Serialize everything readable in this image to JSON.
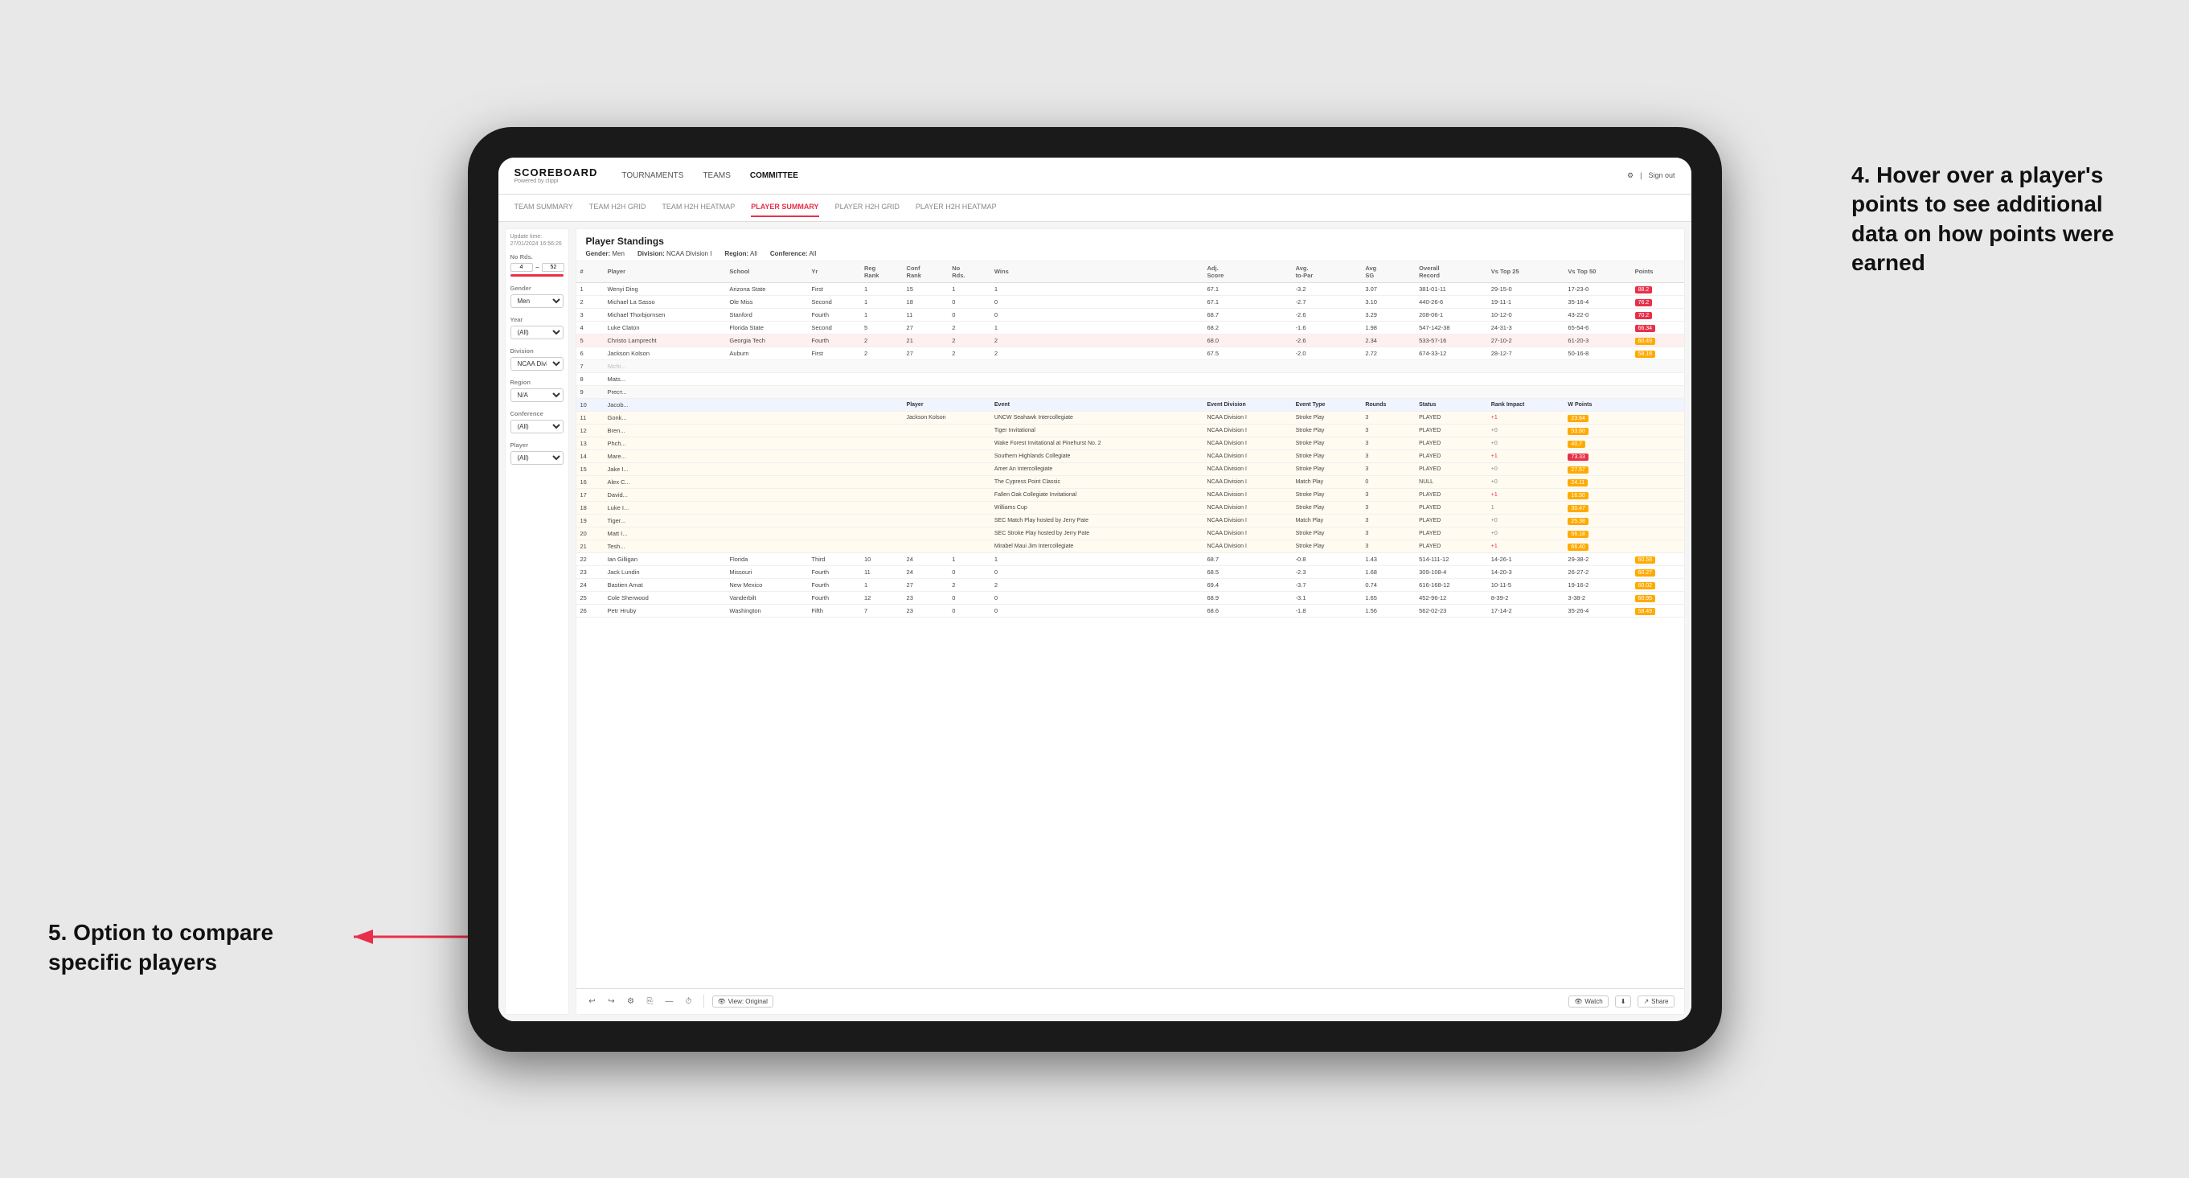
{
  "app": {
    "logo": "SCOREBOARD",
    "logo_sub": "Powered by clippi",
    "sign_out": "Sign out"
  },
  "nav": {
    "links": [
      "TOURNAMENTS",
      "TEAMS",
      "COMMITTEE"
    ],
    "active": "COMMITTEE"
  },
  "sub_nav": {
    "links": [
      "TEAM SUMMARY",
      "TEAM H2H GRID",
      "TEAM H2H HEATMAP",
      "PLAYER SUMMARY",
      "PLAYER H2H GRID",
      "PLAYER H2H HEATMAP"
    ],
    "active": "PLAYER SUMMARY"
  },
  "update_time_label": "Update time:",
  "update_time": "27/01/2024 16:56:26",
  "standings": {
    "title": "Player Standings",
    "filters": [
      {
        "label": "Gender:",
        "value": "Men"
      },
      {
        "label": "Division:",
        "value": "NCAA Division I"
      },
      {
        "label": "Region:",
        "value": "All"
      },
      {
        "label": "Conference:",
        "value": "All"
      }
    ]
  },
  "sidebar": {
    "no_rds_label": "No Rds.",
    "no_rds_min": "4",
    "no_rds_max": "52",
    "gender_label": "Gender",
    "gender_value": "Men",
    "year_label": "Year",
    "year_value": "(All)",
    "division_label": "Division",
    "division_value": "NCAA Division I",
    "region_label": "Region",
    "region_value": "N/A",
    "conference_label": "Conference",
    "conference_value": "(All)",
    "player_label": "Player",
    "player_value": "(All)"
  },
  "table_headers": [
    "#",
    "Player",
    "School",
    "Yr",
    "Reg Rank",
    "Conf Rank",
    "No Rds.",
    "Wins",
    "Adj. Score",
    "Avg to-Par",
    "Avg SG",
    "Overall Record",
    "Vs Top 25",
    "Vs Top 50",
    "Points"
  ],
  "players": [
    {
      "num": 1,
      "name": "Wenyi Ding",
      "school": "Arizona State",
      "yr": "First",
      "reg_rank": 1,
      "conf_rank": 15,
      "no_rds": 1,
      "wins": 1,
      "adj_score": 67.1,
      "to_par": -3.2,
      "avg_sg": 3.07,
      "overall": "381-01-11",
      "vs25": "29-15-0",
      "vs50": "17-23-0",
      "points": "88.2",
      "pts_class": "red"
    },
    {
      "num": 2,
      "name": "Michael La Sasso",
      "school": "Ole Miss",
      "yr": "Second",
      "reg_rank": 1,
      "conf_rank": 18,
      "no_rds": 0,
      "wins": 0,
      "adj_score": 67.1,
      "to_par": -2.7,
      "avg_sg": 3.1,
      "overall": "440-26-6",
      "vs25": "19-11-1",
      "vs50": "35-16-4",
      "points": "76.2",
      "pts_class": "red"
    },
    {
      "num": 3,
      "name": "Michael Thorbjornsen",
      "school": "Stanford",
      "yr": "Fourth",
      "reg_rank": 1,
      "conf_rank": 11,
      "no_rds": 0,
      "wins": 0,
      "adj_score": 68.7,
      "to_par": -2.6,
      "avg_sg": 3.29,
      "overall": "208-06-1",
      "vs25": "10-12-0",
      "vs50": "43-22-0",
      "points": "70.2",
      "pts_class": "red"
    },
    {
      "num": 4,
      "name": "Luke Claton",
      "school": "Florida State",
      "yr": "Second",
      "reg_rank": 5,
      "conf_rank": 27,
      "no_rds": 2,
      "wins": 1,
      "adj_score": 68.2,
      "to_par": -1.6,
      "avg_sg": 1.98,
      "overall": "547-142-38",
      "vs25": "24-31-3",
      "vs50": "65-54-6",
      "points": "66.34",
      "pts_class": "red"
    },
    {
      "num": 5,
      "name": "Christo Lamprecht",
      "school": "Georgia Tech",
      "yr": "Fourth",
      "reg_rank": 2,
      "conf_rank": 21,
      "no_rds": 2,
      "wins": 2,
      "adj_score": 68.0,
      "to_par": -2.6,
      "avg_sg": 2.34,
      "overall": "533-57-16",
      "vs25": "27-10-2",
      "vs50": "61-20-3",
      "points": "60.49",
      "pts_class": "orange"
    },
    {
      "num": 6,
      "name": "Jackson Kolson",
      "school": "Auburn",
      "yr": "First",
      "reg_rank": 2,
      "conf_rank": 27,
      "no_rds": 2,
      "wins": 2,
      "adj_score": 67.5,
      "to_par": -2.0,
      "avg_sg": 2.72,
      "overall": "674-33-12",
      "vs25": "28-12-7",
      "vs50": "50-16-8",
      "points": "58.18",
      "pts_class": "orange"
    }
  ],
  "tooltip_headers": [
    "Player",
    "Event",
    "Event Division",
    "Event Type",
    "Rounds",
    "Status",
    "Rank Impact",
    "W Points"
  ],
  "tooltip_rows": [
    {
      "player": "Jackson Kolson",
      "event": "UNCW Seahawk Intercollegiate",
      "div": "NCAA Division I",
      "type": "Stroke Play",
      "rounds": 3,
      "status": "PLAYED",
      "rank": "+1",
      "wpoints": "23.64",
      "wclass": "orange"
    },
    {
      "player": "",
      "event": "Tiger Invitational",
      "div": "NCAA Division I",
      "type": "Stroke Play",
      "rounds": 3,
      "status": "PLAYED",
      "rank": "+0",
      "wpoints": "53.60",
      "wclass": "orange"
    },
    {
      "player": "",
      "event": "Wake Forest Invitational at Pinehurst No. 2",
      "div": "NCAA Division I",
      "type": "Stroke Play",
      "rounds": 3,
      "status": "PLAYED",
      "rank": "+0",
      "wpoints": "40.7",
      "wclass": "orange"
    },
    {
      "player": "",
      "event": "Southern Highlands Collegiate",
      "div": "NCAA Division I",
      "type": "Stroke Play",
      "rounds": 3,
      "status": "PLAYED",
      "rank": "+1",
      "wpoints": "73.33",
      "wclass": "red"
    },
    {
      "player": "",
      "event": "Amer An Intercollegiate",
      "div": "NCAA Division I",
      "type": "Stroke Play",
      "rounds": 3,
      "status": "PLAYED",
      "rank": "+0",
      "wpoints": "27.57",
      "wclass": "orange"
    },
    {
      "player": "",
      "event": "The Cypress Point Classic",
      "div": "NCAA Division I",
      "type": "Match Play",
      "rounds": 0,
      "status": "NULL",
      "rank": "+0",
      "wpoints": "24.11",
      "wclass": "orange"
    },
    {
      "player": "",
      "event": "Fallen Oak Collegiate Invitational",
      "div": "NCAA Division I",
      "type": "Stroke Play",
      "rounds": 3,
      "status": "PLAYED",
      "rank": "+1",
      "wpoints": "16.50",
      "wclass": "orange"
    },
    {
      "player": "",
      "event": "Williams Cup",
      "div": "NCAA Division I",
      "type": "Stroke Play",
      "rounds": 3,
      "status": "PLAYED",
      "rank": "1",
      "wpoints": "30.47",
      "wclass": "orange"
    },
    {
      "player": "",
      "event": "SEC Match Play hosted by Jerry Pate",
      "div": "NCAA Division I",
      "type": "Match Play",
      "rounds": 0,
      "status": "NULL",
      "rank": "+0",
      "wpoints": "25.38",
      "wclass": "orange"
    },
    {
      "player": "",
      "event": "SEC Stroke Play hosted by Jerry Pate",
      "div": "NCAA Division I",
      "type": "Stroke Play",
      "rounds": 3,
      "status": "PLAYED",
      "rank": "+0",
      "wpoints": "56.18",
      "wclass": "orange"
    },
    {
      "player": "",
      "event": "Mirabel Maui Jim Intercollegiate",
      "div": "NCAA Division I",
      "type": "Stroke Play",
      "rounds": 3,
      "status": "PLAYED",
      "rank": "+1",
      "wpoints": "66.40",
      "wclass": "orange"
    }
  ],
  "lower_players": [
    {
      "num": 22,
      "name": "Ian Gilligan",
      "school": "Florida",
      "yr": "Third",
      "reg_rank": 10,
      "conf_rank": 24,
      "no_rds": 1,
      "wins": 1,
      "adj_score": 68.7,
      "to_par": -0.8,
      "avg_sg": 1.43,
      "overall": "514-111-12",
      "vs25": "14-26-1",
      "vs50": "29-38-2",
      "points": "60.58",
      "pts_class": "orange"
    },
    {
      "num": 23,
      "name": "Jack Lundin",
      "school": "Missouri",
      "yr": "Fourth",
      "reg_rank": 11,
      "conf_rank": 24,
      "no_rds": 0,
      "wins": 0,
      "adj_score": 68.5,
      "to_par": -2.3,
      "avg_sg": 1.68,
      "overall": "309-108-4",
      "vs25": "14-20-3",
      "vs50": "26-27-2",
      "points": "60.27",
      "pts_class": "orange"
    },
    {
      "num": 24,
      "name": "Bastien Amat",
      "school": "New Mexico",
      "yr": "Fourth",
      "reg_rank": 1,
      "conf_rank": 27,
      "no_rds": 2,
      "wins": 2,
      "adj_score": 69.4,
      "to_par": -3.7,
      "avg_sg": 0.74,
      "overall": "616-168-12",
      "vs25": "10-11-5",
      "vs50": "19-16-2",
      "points": "60.02",
      "pts_class": "orange"
    },
    {
      "num": 25,
      "name": "Cole Sherwood",
      "school": "Vanderbilt",
      "yr": "Fourth",
      "reg_rank": 12,
      "conf_rank": 23,
      "no_rds": 0,
      "wins": 0,
      "adj_score": 68.9,
      "to_par": -3.1,
      "avg_sg": 1.65,
      "overall": "452-96-12",
      "vs25": "8-39-2",
      "vs50": "3-38-2",
      "points": "60.95",
      "pts_class": "orange"
    },
    {
      "num": 26,
      "name": "Petr Hruby",
      "school": "Washington",
      "yr": "Fifth",
      "reg_rank": 7,
      "conf_rank": 23,
      "no_rds": 0,
      "wins": 0,
      "adj_score": 68.6,
      "to_par": -1.8,
      "avg_sg": 1.56,
      "overall": "562-02-23",
      "vs25": "17-14-2",
      "vs50": "35-26-4",
      "points": "58.49",
      "pts_class": "orange"
    }
  ],
  "toolbar": {
    "view_original": "View: Original",
    "watch": "Watch",
    "share": "Share"
  },
  "annotations": {
    "right": "4. Hover over a player's points to see additional data on how points were earned",
    "left": "5. Option to compare specific players"
  }
}
